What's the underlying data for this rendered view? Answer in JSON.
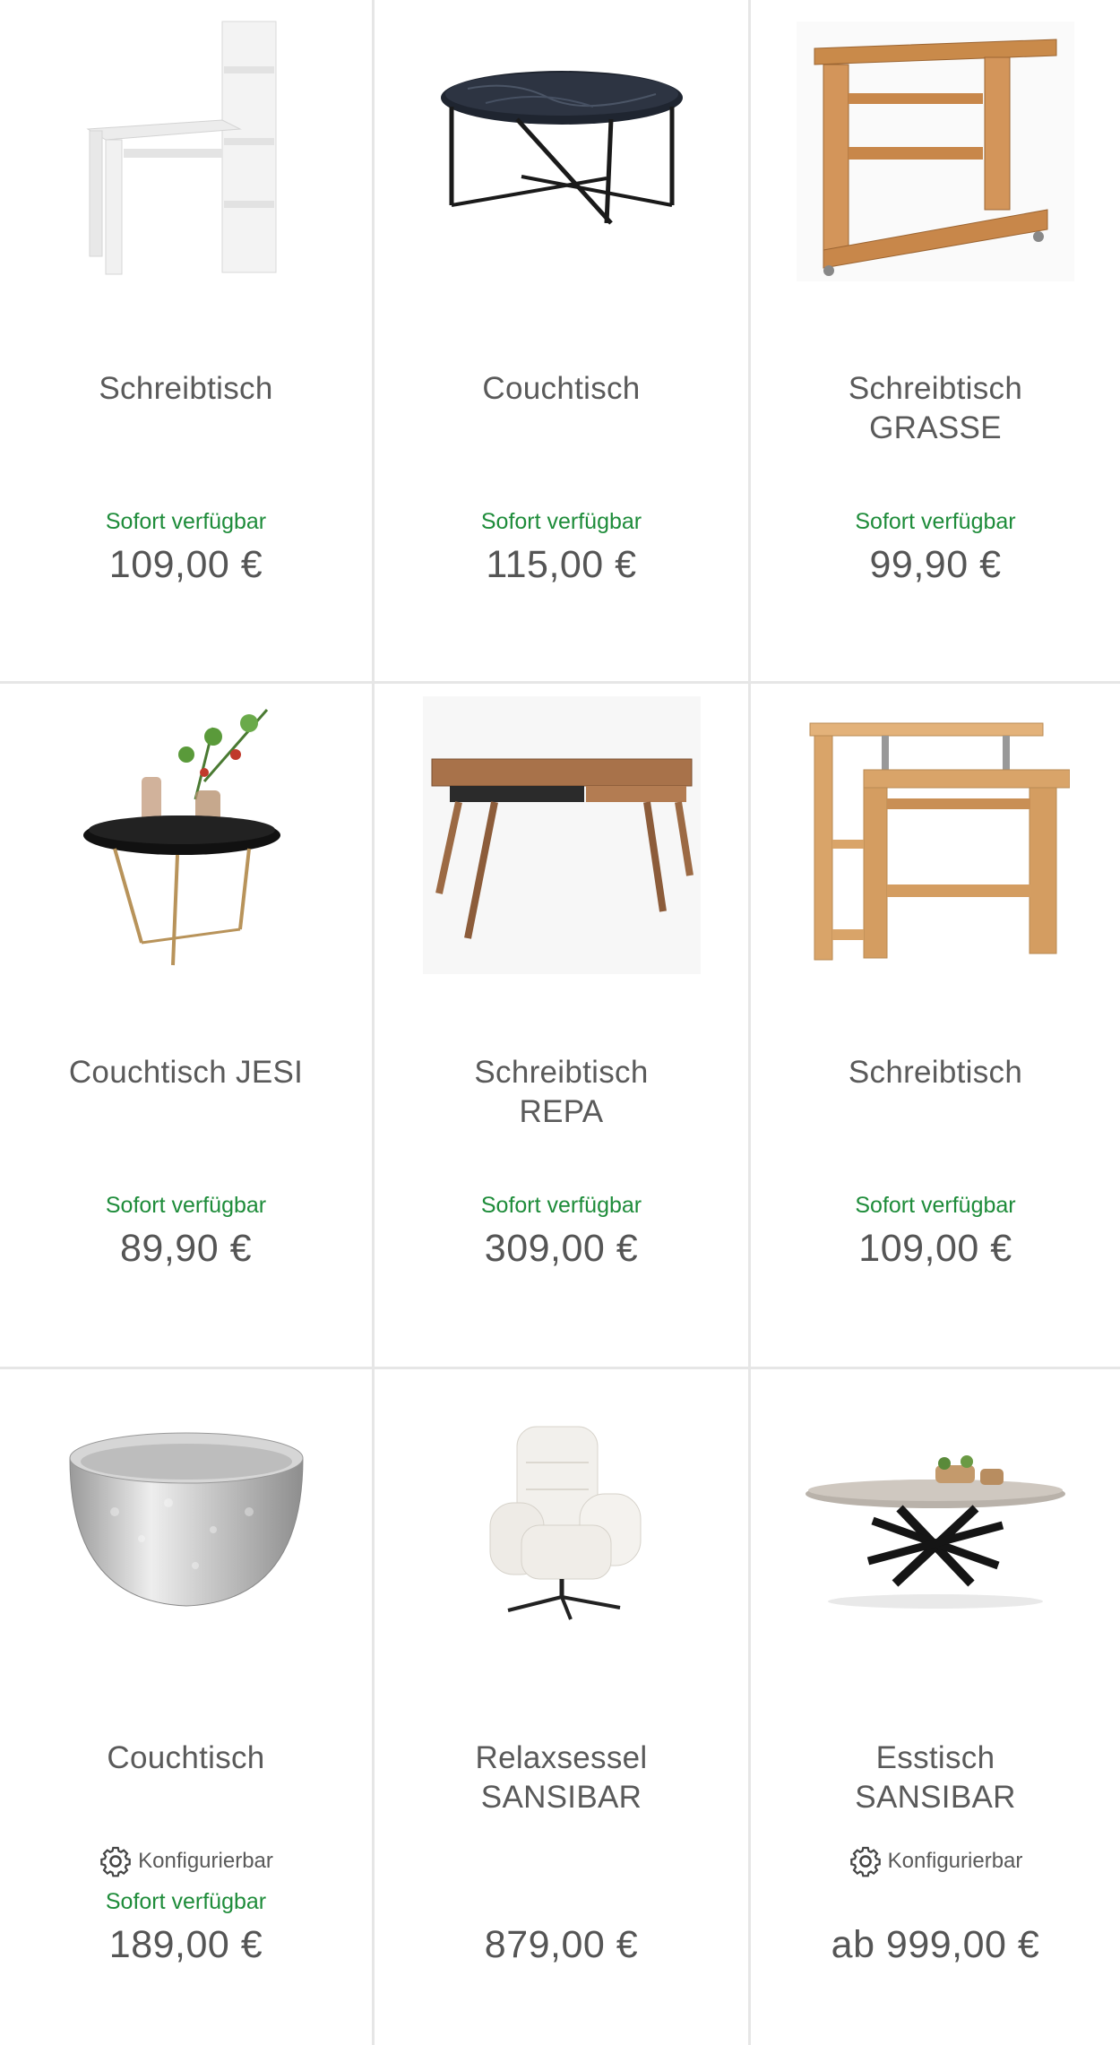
{
  "products": [
    {
      "title_lines": [
        "Schreibtisch"
      ],
      "availability": "Sofort verfügbar",
      "price": "109,00 €",
      "configurable": "",
      "image": "white-desk-image"
    },
    {
      "title_lines": [
        "Couchtisch"
      ],
      "availability": "Sofort verfügbar",
      "price": "115,00 €",
      "configurable": "",
      "image": "marble-coffee-table-image"
    },
    {
      "title_lines": [
        "Schreibtisch",
        "GRASSE"
      ],
      "availability": "Sofort verfügbar",
      "price": "99,90 €",
      "configurable": "",
      "image": "wood-computer-desk-image"
    },
    {
      "title_lines": [
        "Couchtisch JESI"
      ],
      "availability": "Sofort verfügbar",
      "price": "89,90 €",
      "configurable": "",
      "image": "tray-side-table-image"
    },
    {
      "title_lines": [
        "Schreibtisch",
        "REPA"
      ],
      "availability": "Sofort verfügbar",
      "price": "309,00 €",
      "configurable": "",
      "image": "walnut-desk-image"
    },
    {
      "title_lines": [
        "Schreibtisch"
      ],
      "availability": "Sofort verfügbar",
      "price": "109,00 €",
      "configurable": "",
      "image": "beech-computer-desk-image"
    },
    {
      "title_lines": [
        "Couchtisch"
      ],
      "availability": "Sofort verfügbar",
      "price": "189,00 €",
      "configurable": "Konfigurierbar",
      "image": "silver-bowl-table-image"
    },
    {
      "title_lines": [
        "Relaxsessel",
        "SANSIBAR"
      ],
      "availability": "",
      "price": "879,00 €",
      "configurable": "",
      "image": "armchair-image"
    },
    {
      "title_lines": [
        "Esstisch",
        "SANSIBAR"
      ],
      "availability": "",
      "price": "ab 999,00 €",
      "configurable": "Konfigurierbar",
      "image": "dining-table-image"
    }
  ],
  "colors": {
    "availability_green": "#1e8c3a",
    "text_gray": "#555555",
    "divider": "#e6e6e6"
  },
  "icons": {
    "configurable": "gear-icon"
  }
}
